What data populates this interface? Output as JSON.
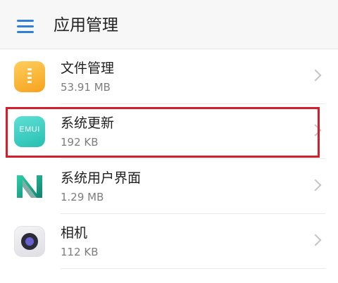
{
  "header": {
    "title": "应用管理",
    "menu_icon": "hamburger-menu-icon",
    "accent_color": "#2f7ed8"
  },
  "apps": [
    {
      "name": "文件管理",
      "size": "53.91 MB",
      "icon": "files-icon"
    },
    {
      "name": "系统更新",
      "size": "192 KB",
      "icon": "system-update-icon",
      "icon_text": "EMUI"
    },
    {
      "name": "系统用户界面",
      "size": "1.29 MB",
      "icon": "system-ui-icon"
    },
    {
      "name": "相机",
      "size": "112 KB",
      "icon": "camera-icon"
    }
  ],
  "highlight": {
    "color": "#d21f2b"
  }
}
